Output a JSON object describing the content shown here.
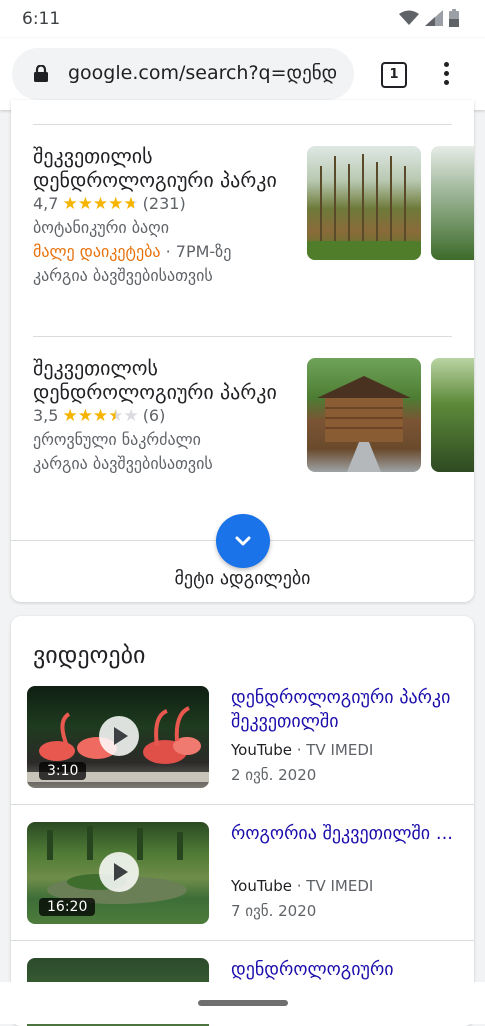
{
  "status": {
    "time": "6:11"
  },
  "browser": {
    "url": "google.com/search?q=დენდ",
    "tab_count": "1"
  },
  "places": [
    {
      "name": "შეკვეთილის დენდროლოგიური პარკი",
      "rating": "4,7",
      "rating_value": 4.7,
      "reviews": "(231)",
      "type": "ბოტანიკური ბაღი",
      "status_closing": "მალე დაიკეტება",
      "status_time": " · 7PM-ზე",
      "note": "კარგია ბავშვებისათვის"
    },
    {
      "name": "შეკვეთილოს დენდროლოგიური პარკი",
      "rating": "3,5",
      "rating_value": 3.5,
      "reviews": "(6)",
      "type": "ეროვნული ნაკრძალი",
      "note": "კარგია ბავშვებისათვის"
    }
  ],
  "more_places_label": "მეტი ადგილები",
  "videos_heading": "ვიდეოები",
  "videos": [
    {
      "title": "დენდროლოგიური პარკი შეკვეთილში",
      "source": "YouTube",
      "channel": " · TV IMEDI",
      "date": "2 ივნ. 2020",
      "duration": "3:10"
    },
    {
      "title": "როგორია შეკვეთილში ...",
      "source": "YouTube",
      "channel": " · TV IMEDI",
      "date": "7 ივნ. 2020",
      "duration": "16:20"
    },
    {
      "title": "დენდროლოგიური"
    }
  ],
  "colors": {
    "link": "#1a0dab",
    "accent": "#1a73e8",
    "star": "#f4b400",
    "closing": "#e8710a"
  }
}
